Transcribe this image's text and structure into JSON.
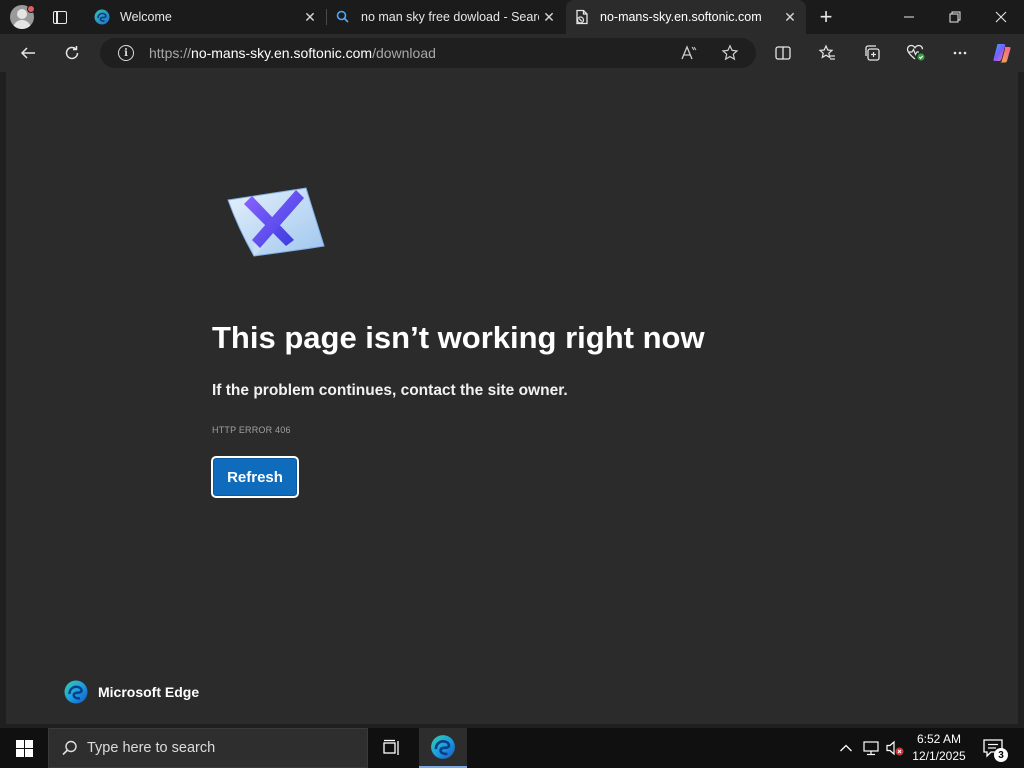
{
  "tabs": [
    {
      "title": "Welcome",
      "icon": "edge-icon",
      "active": false
    },
    {
      "title": "no man sky free dowload - Search",
      "icon": "search-icon",
      "active": false
    },
    {
      "title": "no-mans-sky.en.softonic.com",
      "icon": "broken-page-icon",
      "active": true
    }
  ],
  "addressbar": {
    "url_prefix": "https://",
    "url_host": "no-mans-sky.en.softonic.com",
    "url_path": "/download"
  },
  "error_page": {
    "title": "This page isn’t working right now",
    "subtitle": "If the problem continues, contact the site owner.",
    "code": "HTTP ERROR 406",
    "refresh_label": "Refresh",
    "brand": "Microsoft Edge"
  },
  "taskbar": {
    "search_placeholder": "Type here to search",
    "time": "6:52 AM",
    "date": "12/1/2025",
    "notifications": "3"
  },
  "colors": {
    "accent": "#0f6cbd",
    "page_bg": "#2b2b2b",
    "frame_bg": "#1b1b1b"
  }
}
